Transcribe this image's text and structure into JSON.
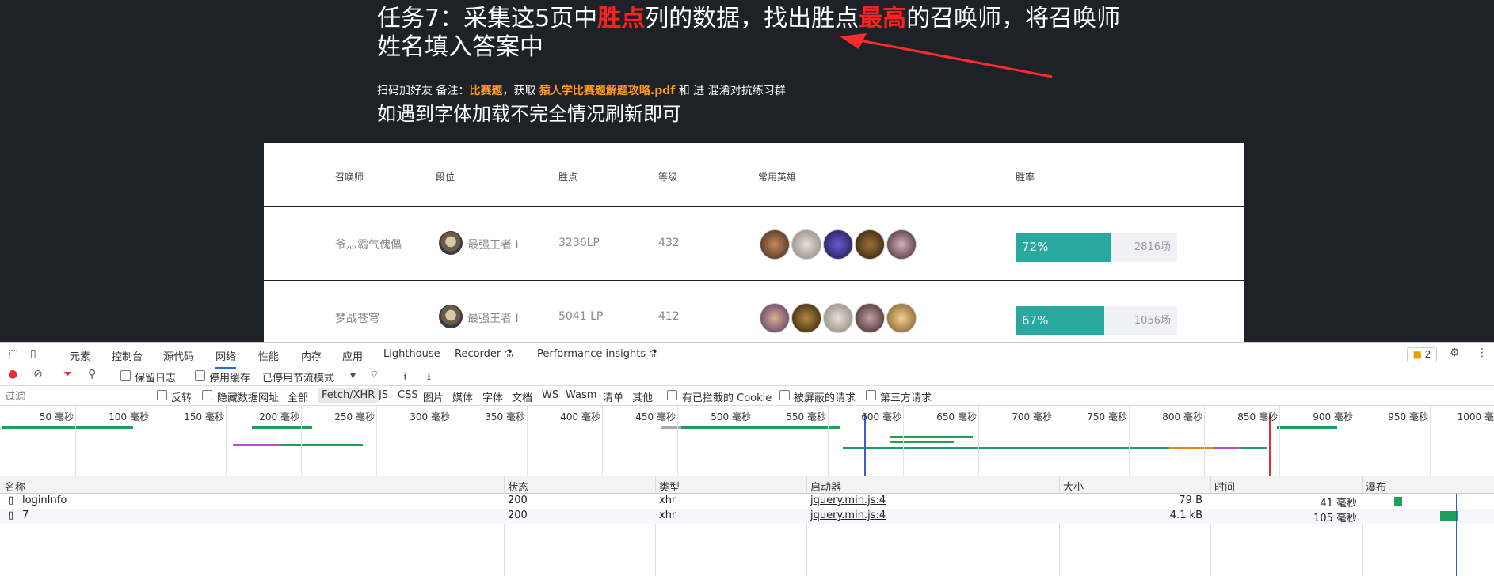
{
  "task": {
    "line1_a": "任务7：采集这5页中",
    "line1_b": "胜点",
    "line1_c": "列的数据，找出胜点",
    "line1_d": "最高",
    "line1_e": "的召唤师，将召唤师",
    "line2": "姓名填入答案中"
  },
  "subline": {
    "a": "扫码加好友 备注：",
    "b": "比赛题",
    "c": "，获取 ",
    "d": "猿人学比赛题解题攻略.pdf",
    "e": " 和 进 混淆对抗练习群"
  },
  "note": "如遇到字体加载不完全情况刷新即可",
  "table": {
    "headers": [
      "召唤师",
      "段位",
      "胜点",
      "等级",
      "常用英雄",
      "胜率"
    ],
    "rows": [
      {
        "name": "爷灬霸气傀儡",
        "rank": "最强王者 I",
        "lp": "3236LP",
        "level": "432",
        "winrate_label": "72%",
        "winrate": 0.72,
        "games": "2816场"
      },
      {
        "name": "梦战苍穹",
        "rank": "最强王者 I",
        "lp": "5041 LP",
        "level": "412",
        "winrate_label": "67%",
        "winrate": 0.67,
        "games": "1056场"
      }
    ]
  },
  "devtools": {
    "tabs": [
      "元素",
      "控制台",
      "源代码",
      "网络",
      "性能",
      "内存",
      "应用",
      "Lighthouse",
      "Recorder",
      "Performance insights"
    ],
    "active_tab": "网络",
    "badge": "2",
    "toolbar": {
      "preserve_log": "保留日志",
      "disable_cache": "停用缓存",
      "throttle": "已停用节流模式"
    },
    "filter_placeholder": "过滤",
    "filter_opts": {
      "invert": "反转",
      "hide_data": "隐藏数据网址",
      "all": "全部"
    },
    "types": [
      "Fetch/XHR",
      "JS",
      "CSS",
      "图片",
      "媒体",
      "字体",
      "文档",
      "WS",
      "Wasm",
      "清单",
      "其他"
    ],
    "extra_filters": {
      "blocked_cookies": "有已拦截的 Cookie",
      "blocked_requests": "被屏蔽的请求",
      "third_party": "第三方请求"
    },
    "timeline_ticks": [
      "50 毫秒",
      "100 毫秒",
      "150 毫秒",
      "200 毫秒",
      "250 毫秒",
      "300 毫秒",
      "350 毫秒",
      "400 毫秒",
      "450 毫秒",
      "500 毫秒",
      "550 毫秒",
      "600 毫秒",
      "650 毫秒",
      "700 毫秒",
      "750 毫秒",
      "800 毫秒",
      "850 毫秒",
      "900 毫秒",
      "950 毫秒",
      "1000 毫秒"
    ],
    "columns": [
      "名称",
      "状态",
      "类型",
      "启动器",
      "大小",
      "时间",
      "瀑布"
    ],
    "requests": [
      {
        "name": "loginInfo",
        "status": "200",
        "type": "xhr",
        "initiator": "jquery.min.js:4",
        "size": "79 B",
        "time": "41 毫秒"
      },
      {
        "name": "7",
        "status": "200",
        "type": "xhr",
        "initiator": "jquery.min.js:4",
        "size": "4.1 kB",
        "time": "105 毫秒"
      }
    ]
  }
}
